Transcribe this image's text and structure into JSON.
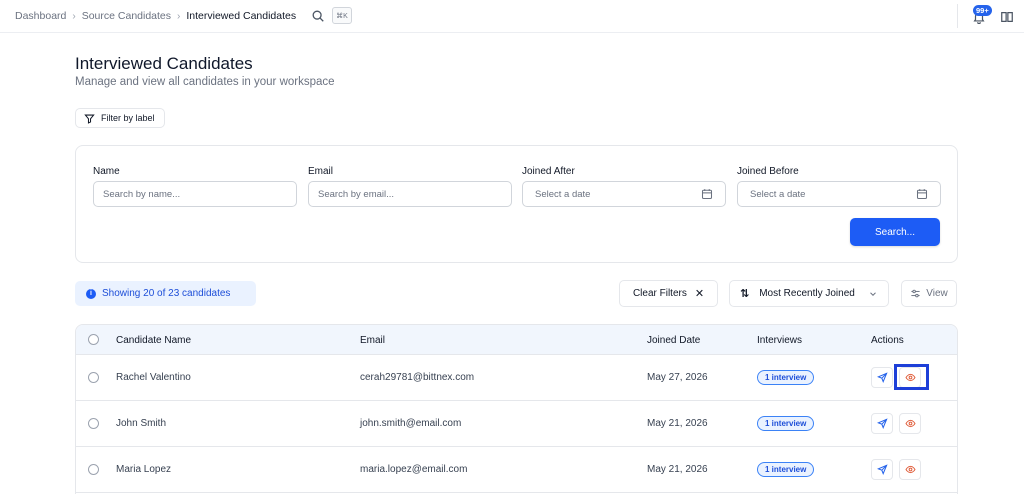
{
  "breadcrumb": {
    "items": [
      "Dashboard",
      "Source Candidates",
      "Interviewed Candidates"
    ],
    "separator": "›"
  },
  "topbar": {
    "shortcut": "⌘K",
    "notifications_badge": "99+"
  },
  "header": {
    "title": "Interviewed Candidates",
    "subtitle": "Manage and view all candidates in your workspace",
    "filter_by_label": "Filter by label"
  },
  "filters": {
    "name_label": "Name",
    "name_placeholder": "Search by name...",
    "email_label": "Email",
    "email_placeholder": "Search by email...",
    "joined_after_label": "Joined After",
    "joined_after_placeholder": "Select a date",
    "joined_before_label": "Joined Before",
    "joined_before_placeholder": "Select a date",
    "search_button": "Search..."
  },
  "toolbar": {
    "showing_text": "Showing 20 of 23 candidates",
    "info_glyph": "i",
    "clear_filters": "Clear Filters",
    "clear_glyph": "✕",
    "sort_glyph": "⇅",
    "sort_value": "Most Recently Joined",
    "view_button": "View"
  },
  "table": {
    "columns": [
      "Candidate Name",
      "Email",
      "Joined Date",
      "Interviews",
      "Actions"
    ],
    "rows": [
      {
        "name": "Rachel Valentino",
        "email": "cerah29781@bittnex.com",
        "joined": "May 27, 2026",
        "interviews": "1 interview"
      },
      {
        "name": "John Smith",
        "email": "john.smith@email.com",
        "joined": "May 21, 2026",
        "interviews": "1 interview"
      },
      {
        "name": "Maria Lopez",
        "email": "maria.lopez@email.com",
        "joined": "May 21, 2026",
        "interviews": "1 interview"
      }
    ]
  },
  "colors": {
    "primary": "#1d5cf5",
    "action_send": "#2563eb",
    "action_view": "#e05d3a",
    "highlight": "#1d3fd8"
  }
}
